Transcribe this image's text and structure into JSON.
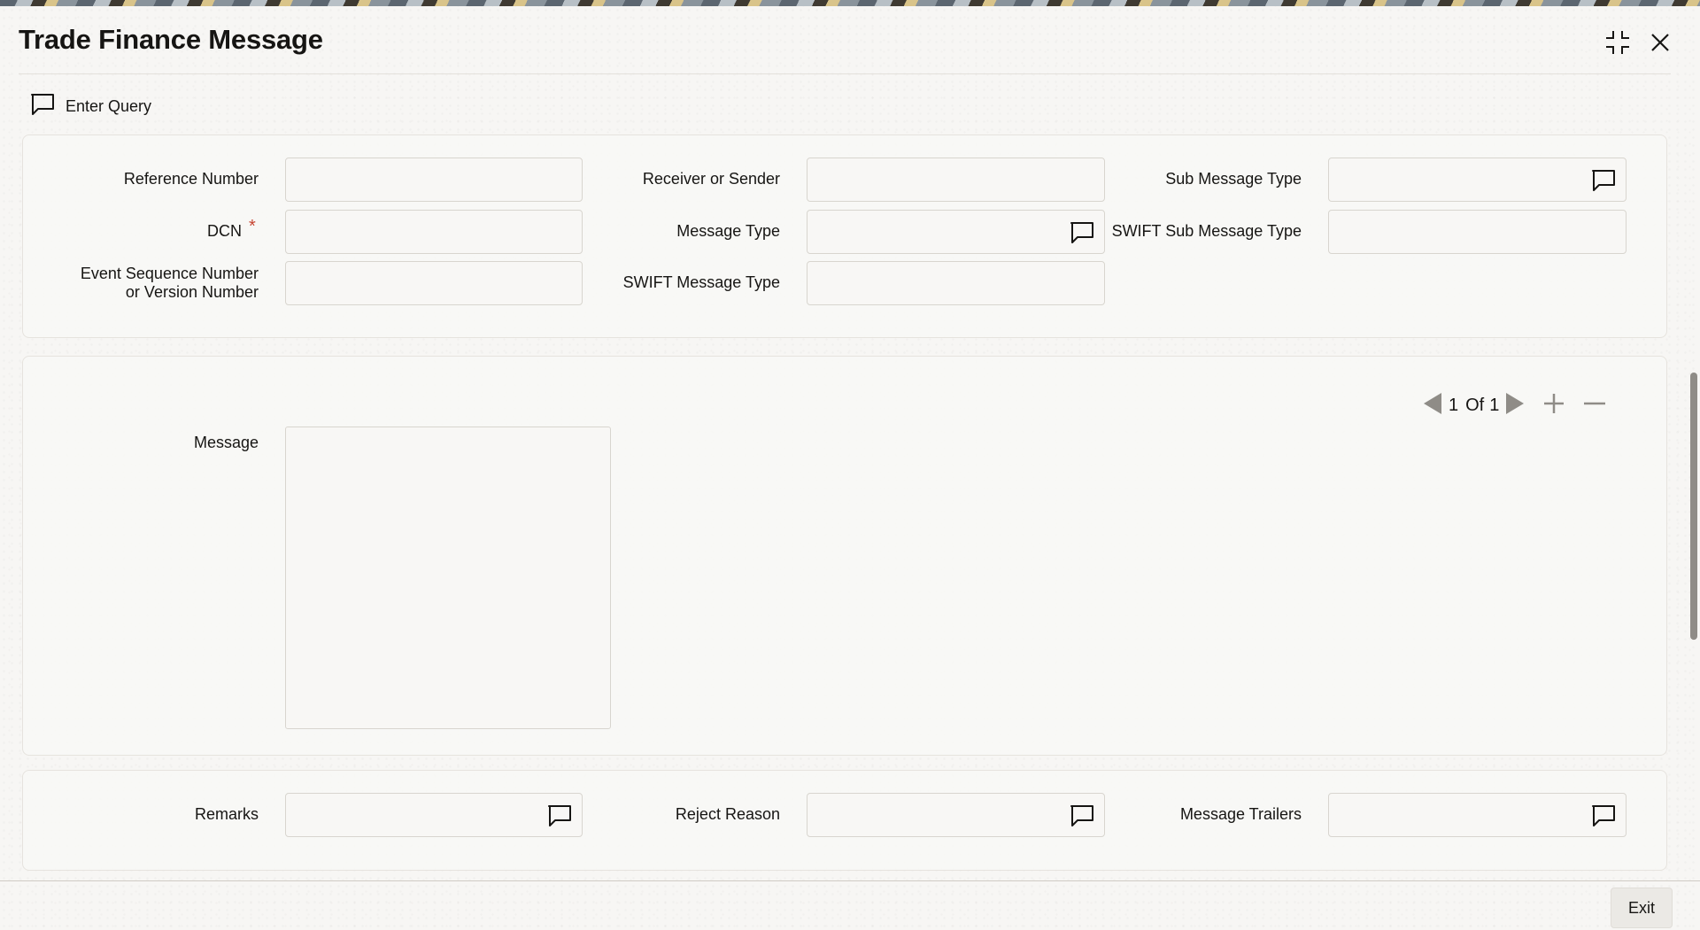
{
  "window": {
    "title": "Trade Finance Message"
  },
  "toolbar": {
    "enter_query_label": "Enter Query"
  },
  "header_fields": {
    "reference_number": {
      "label": "Reference Number",
      "value": ""
    },
    "dcn": {
      "label": "DCN",
      "required_marker": "*",
      "value": ""
    },
    "event_sequence": {
      "label_line1": "Event Sequence Number",
      "label_line2": "or Version Number",
      "value": ""
    },
    "receiver_or_sender": {
      "label": "Receiver or Sender",
      "value": ""
    },
    "message_type": {
      "label": "Message Type",
      "value": ""
    },
    "swift_message_type": {
      "label": "SWIFT Message Type",
      "value": ""
    },
    "sub_message_type": {
      "label": "Sub Message Type",
      "value": ""
    },
    "swift_sub_message_type": {
      "label": "SWIFT Sub Message Type",
      "value": ""
    }
  },
  "message_section": {
    "label": "Message",
    "value": "",
    "pager": {
      "current": "1",
      "of_label": "Of",
      "total": "1"
    }
  },
  "footer_fields": {
    "remarks": {
      "label": "Remarks",
      "value": ""
    },
    "reject_reason": {
      "label": "Reject Reason",
      "value": ""
    },
    "message_trailers": {
      "label": "Message Trailers",
      "value": ""
    }
  },
  "scrollbar": {
    "position": 0.5
  },
  "footer": {
    "exit_label": "Exit"
  },
  "icons": {
    "lov": "speech-bubble-icon",
    "maximize": "collapse-icon",
    "close": "close-icon"
  },
  "colors": {
    "required": "#c74634",
    "text": "#161513",
    "panel_background": "#f8f7f5"
  }
}
